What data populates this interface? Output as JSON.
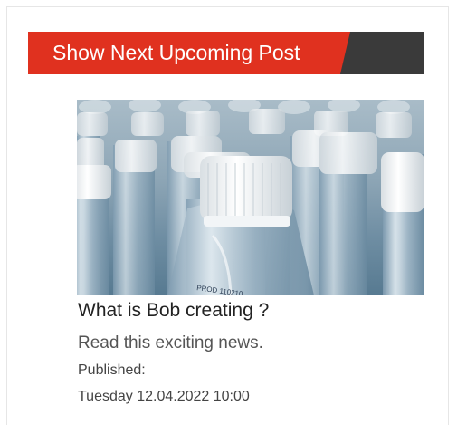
{
  "header": {
    "title": "Show Next Upcoming Post",
    "accent_color": "#e0311f",
    "tail_color": "#3a3a3a"
  },
  "post": {
    "image_subject": "plastic-water-bottles",
    "title": "What is Bob creating ?",
    "excerpt": "Read this exciting news.",
    "published_label": "Published:",
    "published_date": "Tuesday 12.04.2022 10:00",
    "bottle_print": "PROD 110210"
  }
}
